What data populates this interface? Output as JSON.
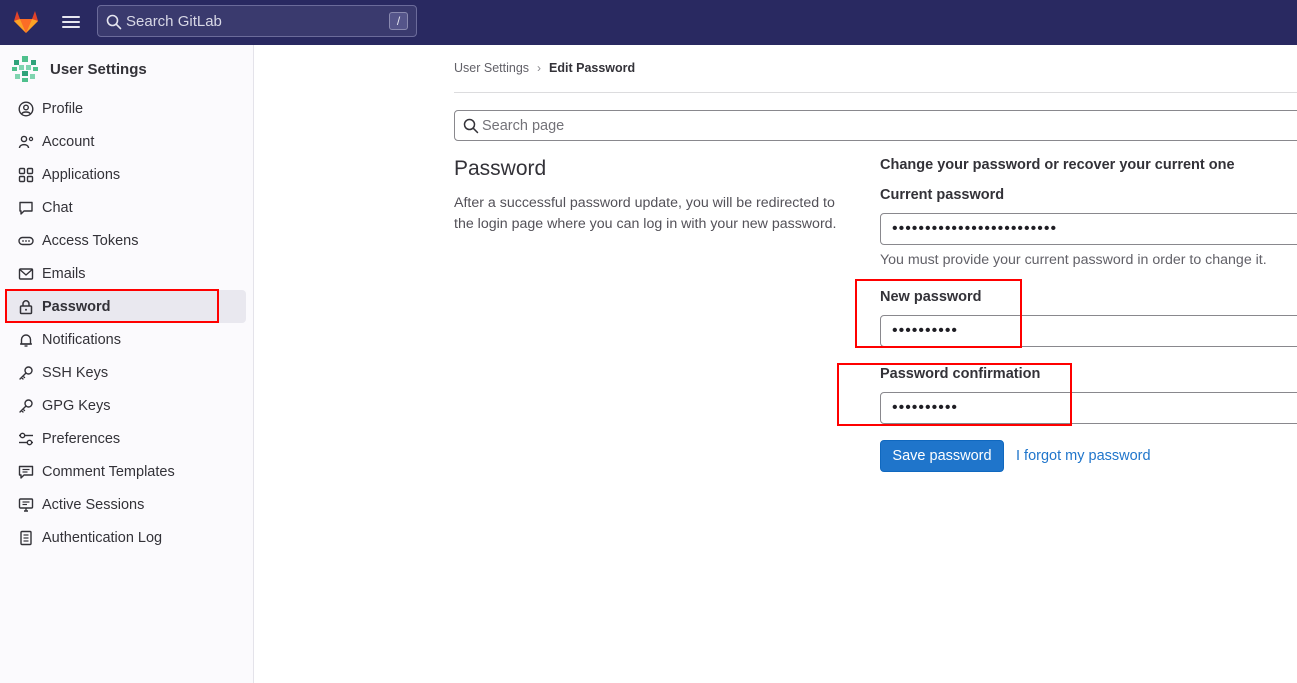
{
  "topbar": {
    "search_placeholder": "Search GitLab",
    "search_shortcut": "/"
  },
  "sidebar": {
    "title": "User Settings",
    "items": [
      {
        "label": "Profile",
        "icon": "profile-icon"
      },
      {
        "label": "Account",
        "icon": "account-icon"
      },
      {
        "label": "Applications",
        "icon": "applications-icon"
      },
      {
        "label": "Chat",
        "icon": "chat-icon"
      },
      {
        "label": "Access Tokens",
        "icon": "token-icon"
      },
      {
        "label": "Emails",
        "icon": "mail-icon"
      },
      {
        "label": "Password",
        "icon": "lock-icon",
        "active": true
      },
      {
        "label": "Notifications",
        "icon": "bell-icon"
      },
      {
        "label": "SSH Keys",
        "icon": "key-icon"
      },
      {
        "label": "GPG Keys",
        "icon": "key-icon"
      },
      {
        "label": "Preferences",
        "icon": "preferences-icon"
      },
      {
        "label": "Comment Templates",
        "icon": "comment-icon"
      },
      {
        "label": "Active Sessions",
        "icon": "monitor-icon"
      },
      {
        "label": "Authentication Log",
        "icon": "log-icon"
      }
    ]
  },
  "breadcrumb": {
    "parent": "User Settings",
    "separator": "›",
    "current": "Edit Password"
  },
  "page_search": {
    "placeholder": "Search page"
  },
  "section": {
    "title": "Password",
    "description": "After a successful password update, you will be redirected to the login page where you can log in with your new password."
  },
  "form": {
    "heading": "Change your password or recover your current one",
    "current_password_label": "Current password",
    "current_password_value": "•••••••••••••••••••••••••",
    "current_password_help": "You must provide your current password in order to change it.",
    "new_password_label": "New password",
    "new_password_value": "••••••••••",
    "confirmation_label": "Password confirmation",
    "confirmation_value": "••••••••••",
    "save_label": "Save password",
    "forgot_label": "I forgot my password"
  },
  "colors": {
    "topbar": "#292961",
    "primary_button": "#1f75cb",
    "link": "#1f75cb",
    "highlight": "#ff0000"
  }
}
